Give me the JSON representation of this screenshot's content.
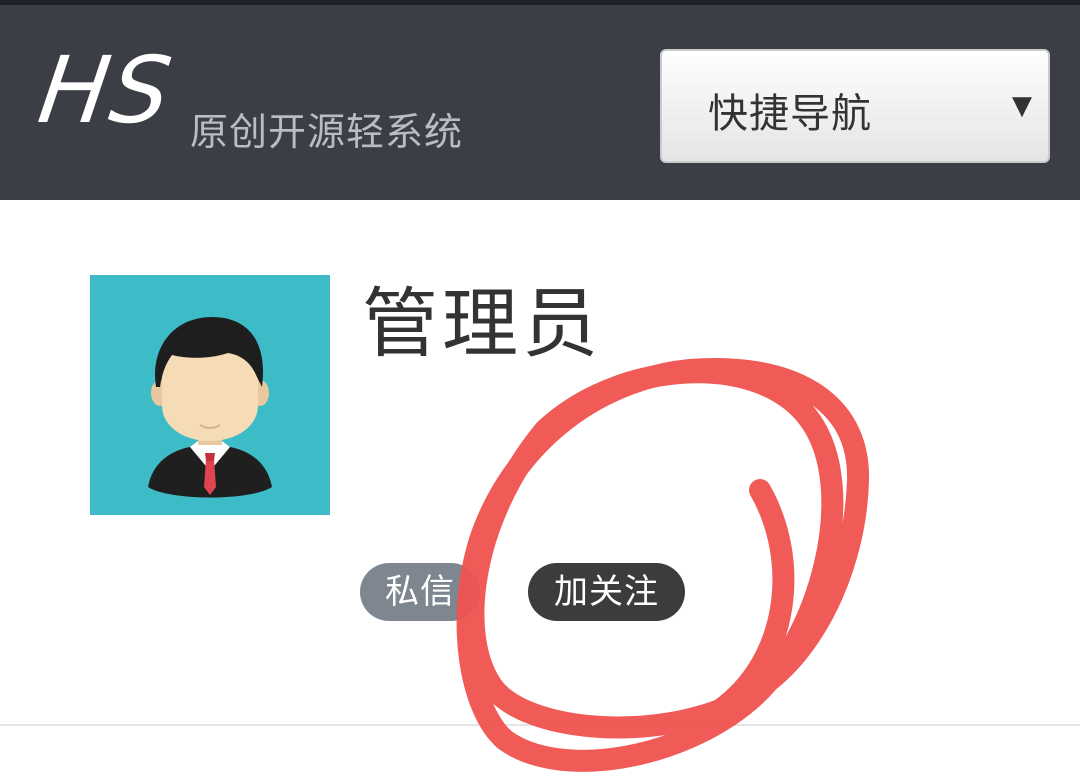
{
  "header": {
    "logo_mark": "HS",
    "logo_subtitle": "原创开源轻系统",
    "quick_nav": {
      "selected": "快捷导航",
      "caret": "▼"
    }
  },
  "profile": {
    "name": "管理员",
    "buttons": {
      "message": "私信",
      "follow": "加关注"
    }
  },
  "colors": {
    "header_bg": "#3b3f45",
    "avatar_bg": "#3dbbc6",
    "message_btn": "#7e8790",
    "follow_btn": "#3c3c3c",
    "annotation": "#ef5350"
  }
}
